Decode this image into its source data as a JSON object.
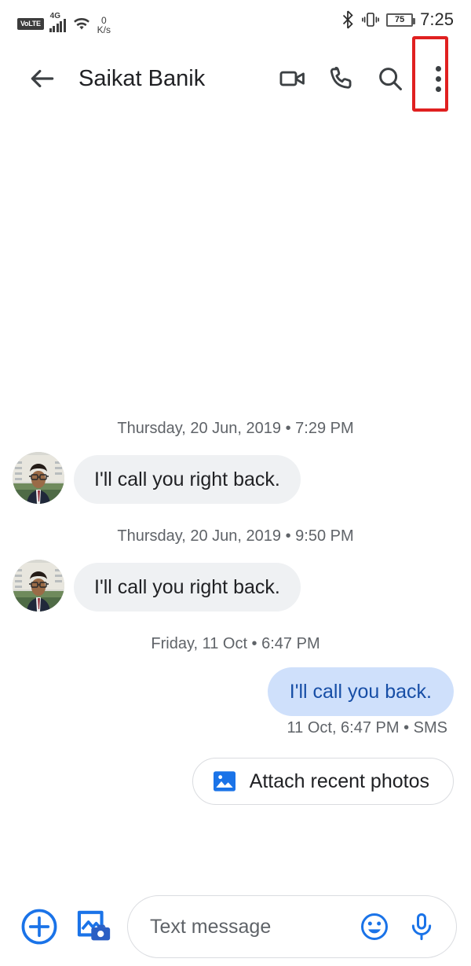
{
  "statusbar": {
    "volte_label": "VoLTE",
    "network_label": "4G",
    "data_rate_value": "0",
    "data_rate_unit": "K/s",
    "battery_percent": "75",
    "clock": "7:25",
    "icons": [
      "volte-icon",
      "signal-bars-icon",
      "wifi-icon",
      "bluetooth-icon",
      "vibrate-icon",
      "battery-icon"
    ]
  },
  "appbar": {
    "back_icon": "back-arrow-icon",
    "contact_name": "Saikat Banik",
    "video_call_icon": "video-call-icon",
    "phone_call_icon": "phone-call-icon",
    "search_icon": "search-icon",
    "overflow_icon": "more-options-icon",
    "highlight_color": "#e02020"
  },
  "thread": {
    "messages": [
      {
        "kind": "daystamp",
        "text": "Thursday, 20 Jun, 2019 • 7:29 PM"
      },
      {
        "kind": "incoming",
        "text": "I'll call you right back.",
        "avatar_name": "contact-avatar"
      },
      {
        "kind": "daystamp",
        "text": "Thursday, 20 Jun, 2019 • 9:50 PM"
      },
      {
        "kind": "incoming",
        "text": "I'll call you right back.",
        "avatar_name": "contact-avatar"
      },
      {
        "kind": "daystamp",
        "text": "Friday, 11 Oct • 6:47 PM"
      },
      {
        "kind": "outgoing",
        "text": "I'll call you back.",
        "meta": "11 Oct, 6:47 PM • SMS"
      }
    ],
    "suggestion_chip": {
      "label": "Attach recent photos",
      "icon": "image-icon"
    },
    "bubble_incoming_color": "#eff1f3",
    "bubble_outgoing_color": "#cfe0fb",
    "outgoing_text_color": "#174ea6"
  },
  "compose": {
    "add_icon": "plus-circle-icon",
    "gallery_icon": "gallery-camera-icon",
    "placeholder": "Text message",
    "emoji_icon": "emoji-icon",
    "mic_icon": "microphone-icon",
    "accent_color": "#1a73e8"
  }
}
